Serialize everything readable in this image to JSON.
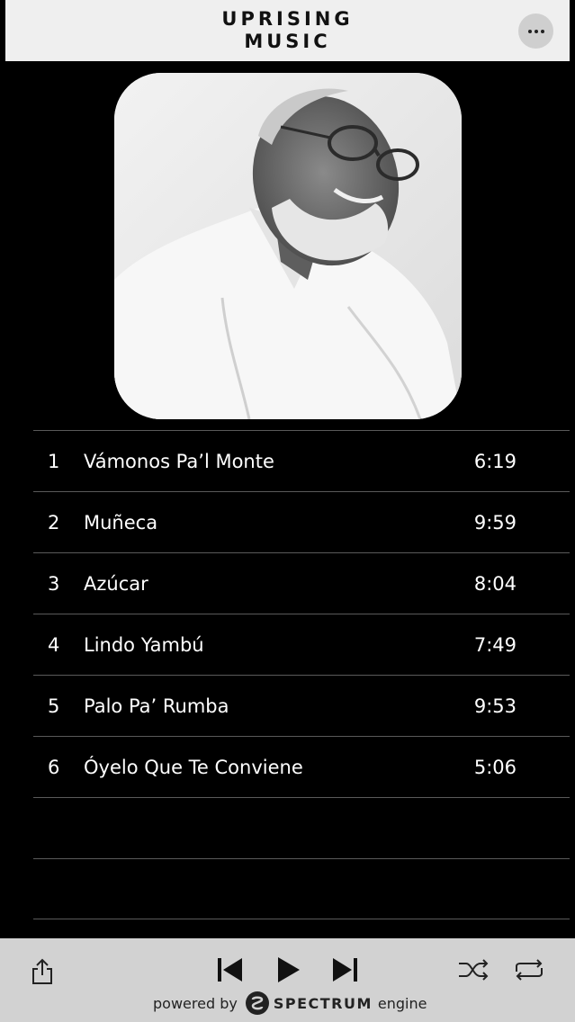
{
  "header": {
    "title_line1": "UPRISING",
    "title_line2": "MUSIC",
    "menu_icon": "more-icon"
  },
  "album": {
    "art_icon": "album-art-photo"
  },
  "tracks": [
    {
      "num": "1",
      "title": "Vámonos Pa’l Monte",
      "duration": "6:19"
    },
    {
      "num": "2",
      "title": "Muñeca",
      "duration": "9:59"
    },
    {
      "num": "3",
      "title": "Azúcar",
      "duration": "8:04"
    },
    {
      "num": "4",
      "title": "Lindo Yambú",
      "duration": "7:49"
    },
    {
      "num": "5",
      "title": "Palo Pa’ Rumba",
      "duration": "9:53"
    },
    {
      "num": "6",
      "title": "Óyelo Que Te Conviene",
      "duration": "5:06"
    }
  ],
  "player": {
    "share_icon": "share-icon",
    "prev_icon": "skip-previous-icon",
    "play_icon": "play-icon",
    "next_icon": "skip-next-icon",
    "shuffle_icon": "shuffle-icon",
    "repeat_icon": "repeat-icon"
  },
  "footer": {
    "powered_by": "powered by",
    "brand": "SPECTRUM",
    "suffix": "engine"
  }
}
